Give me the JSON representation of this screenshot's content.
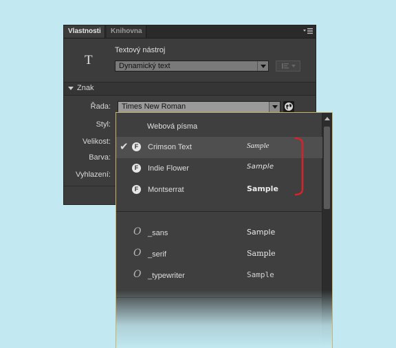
{
  "panel": {
    "tabs": [
      {
        "label": "Vlastnosti",
        "active": true
      },
      {
        "label": "Knihovna",
        "active": false
      }
    ],
    "tool_name": "Textový nástroj",
    "tool_icon_glyph": "T",
    "text_type": "Dynamický text",
    "section_title": "Znak",
    "labels": {
      "family": "Řada:",
      "style": "Styl:",
      "size": "Velikost:",
      "color": "Barva:",
      "antialias": "Vyhlazení:"
    },
    "family_value": "Times New Roman"
  },
  "font_menu": {
    "web_fonts_title": "Webová písma",
    "web_fonts": [
      {
        "name": "Crimson Text",
        "sample": "Sample",
        "selected": true,
        "icon": "font-f-icon"
      },
      {
        "name": "Indie Flower",
        "sample": "Sample",
        "selected": false,
        "icon": "font-f-icon"
      },
      {
        "name": "Montserrat",
        "sample": "Sample",
        "selected": false,
        "icon": "font-f-icon"
      }
    ],
    "device_fonts": [
      {
        "name": "_sans",
        "sample": "Sample",
        "icon": "opentype-o-icon"
      },
      {
        "name": "_serif",
        "sample": "Sample",
        "icon": "opentype-o-icon"
      },
      {
        "name": "_typewriter",
        "sample": "Sample",
        "icon": "opentype-o-icon"
      }
    ]
  },
  "colors": {
    "background": "#c2e9f1",
    "panel": "#3c3c3c",
    "popup_border": "#c9b46a",
    "highlight_bracket": "#d9222a"
  }
}
